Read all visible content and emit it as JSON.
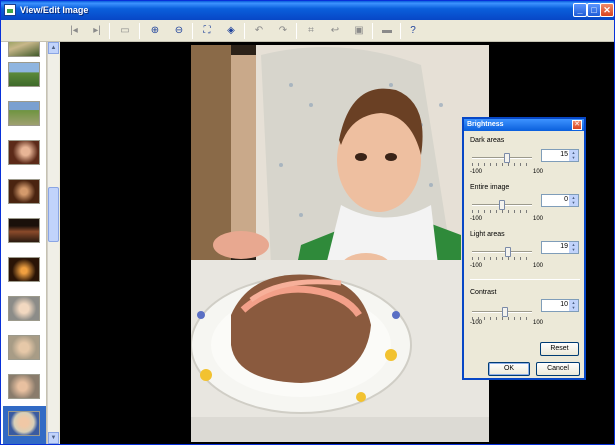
{
  "window": {
    "title": "View/Edit Image",
    "controls": {
      "minimize": "_",
      "maximize": "□",
      "close": "✕"
    }
  },
  "toolbar": {
    "buttons": [
      {
        "name": "first-image-icon",
        "glyph": "|◂"
      },
      {
        "name": "next-image-icon",
        "glyph": "▸|"
      },
      {
        "name": "slideshow-icon",
        "glyph": "▭"
      },
      {
        "name": "zoom-in-icon",
        "glyph": "⊕"
      },
      {
        "name": "zoom-out-icon",
        "glyph": "⊖"
      },
      {
        "name": "fit-window-icon",
        "glyph": "⛶"
      },
      {
        "name": "actual-size-icon",
        "glyph": "◈"
      },
      {
        "name": "rotate-left-icon",
        "glyph": "↶"
      },
      {
        "name": "rotate-right-icon",
        "glyph": "↷"
      },
      {
        "name": "crop-icon",
        "glyph": "⌗"
      },
      {
        "name": "undo-icon",
        "glyph": "↩"
      },
      {
        "name": "save-icon",
        "glyph": "▣"
      },
      {
        "name": "print-icon",
        "glyph": "▬"
      },
      {
        "name": "help-icon",
        "glyph": "?"
      }
    ]
  },
  "brightness_dialog": {
    "title": "Brightness",
    "close": "✕",
    "dark_areas": {
      "label": "Dark areas",
      "value": "15",
      "level": 15,
      "min": "-100",
      "max": "100"
    },
    "entire_image": {
      "label": "Entire image",
      "value": "0",
      "level": 0,
      "min": "-100",
      "max": "100"
    },
    "light_areas": {
      "label": "Light areas",
      "value": "19",
      "level": 19,
      "min": "-100",
      "max": "100"
    },
    "contrast": {
      "label": "Contrast",
      "value": "10",
      "level": 10,
      "min": "-100",
      "max": "100"
    },
    "reset_label": "Reset",
    "ok_label": "OK",
    "cancel_label": "Cancel"
  }
}
